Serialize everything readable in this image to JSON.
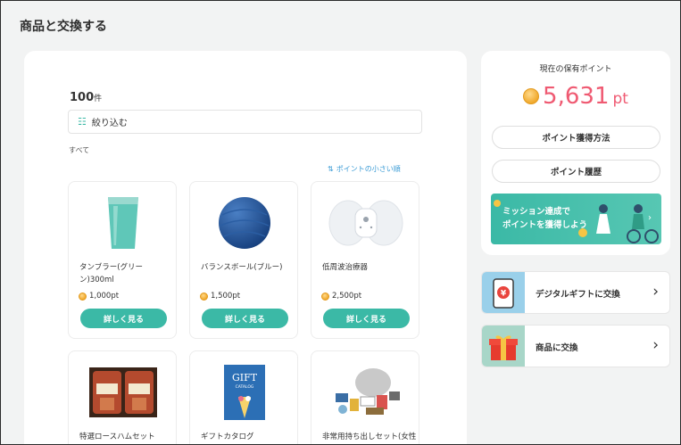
{
  "page": {
    "title": "商品と交換する"
  },
  "list": {
    "count": "100",
    "count_unit": "件",
    "filter_label": "絞り込む",
    "category": "すべて",
    "sort_label": "ポイントの小さい順"
  },
  "products": [
    {
      "name": "タンブラー(グリーン)300ml",
      "price": "1,000pt",
      "button": "詳しく見る",
      "image": "tumbler-image"
    },
    {
      "name": "バランスボール(ブルー)",
      "price": "1,500pt",
      "button": "詳しく見る",
      "image": "balance-ball-image"
    },
    {
      "name": "低周波治療器",
      "price": "2,500pt",
      "button": "詳しく見る",
      "image": "low-frequency-device-image"
    },
    {
      "name": "特選ロースハムセット",
      "image": "ham-set-image"
    },
    {
      "name": "ギフトカタログ",
      "image": "gift-catalog-image",
      "image_text": "GIFT",
      "image_subtext": "CATALOG"
    },
    {
      "name": "非常用持ち出しセット(女性対応)",
      "image": "emergency-kit-image"
    }
  ],
  "points_panel": {
    "label": "現在の保有ポイント",
    "value": "5,631",
    "unit": "pt",
    "how_to_earn": "ポイント獲得方法",
    "history": "ポイント履歴",
    "banner_line1": "ミッション達成で",
    "banner_line2": "ポイントを獲得しよう"
  },
  "exchange": {
    "digital_gift": "デジタルギフトに交換",
    "goods": "商品に交換"
  },
  "colors": {
    "accent": "#3bb9a6",
    "points": "#ef5a72",
    "link": "#3a9bd5"
  }
}
